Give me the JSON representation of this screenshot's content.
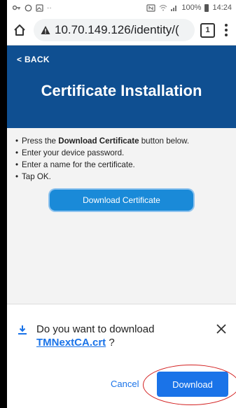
{
  "status_bar": {
    "battery_percent": "100%",
    "time": "14:24",
    "icons": [
      "key-icon",
      "circle-icon",
      "image-icon",
      "dots-icon",
      "nfc-icon",
      "wifi-icon",
      "signal-icon",
      "battery-icon"
    ]
  },
  "address_bar": {
    "url": "10.70.149.126/identity/(",
    "tab_count": "1",
    "security_icon": "warning-icon"
  },
  "header": {
    "back_label": "< BACK",
    "title": "Certificate Installation",
    "background_color": "#0f4f91"
  },
  "instructions": {
    "item1_prefix": "Press the ",
    "item1_bold": "Download Certificate",
    "item1_suffix": " button below.",
    "item2": "Enter your device password.",
    "item3": "Enter a name for the certificate.",
    "item4": "Tap OK."
  },
  "download_certificate_button_label": "Download Certificate",
  "download_prompt": {
    "question": "Do you want to download",
    "filename": "TMNextCA.crt",
    "question_suffix": " ?",
    "cancel_label": "Cancel",
    "download_label": "Download",
    "accent_color": "#1a73e8",
    "highlight_color": "#d32020"
  }
}
